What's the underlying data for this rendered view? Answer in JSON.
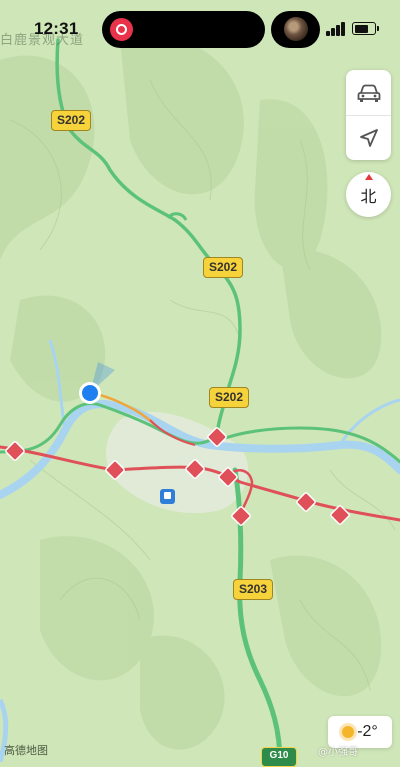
{
  "status_bar": {
    "time": "12:31"
  },
  "map": {
    "place_label_top": "白鹿景观大道",
    "road_badges": [
      "S202",
      "S202",
      "S202",
      "S203"
    ],
    "bottom_badge": "G10",
    "colors": {
      "land": "#cfe6b8",
      "hill_shade": "#b9d6a0",
      "river": "#a9d4f0",
      "highway": "#5cc27a",
      "expressway": "#e05058",
      "town": "#e9ede4",
      "location": "#1f7ff0"
    }
  },
  "controls": {
    "car_icon": "car-icon",
    "locate_icon": "navigation-arrow-icon",
    "compass_label": "北"
  },
  "weather": {
    "icon": "sun-icon",
    "temperature": "-2°"
  },
  "footer": {
    "logo": "高德地图",
    "watermark": "@小强哥"
  }
}
